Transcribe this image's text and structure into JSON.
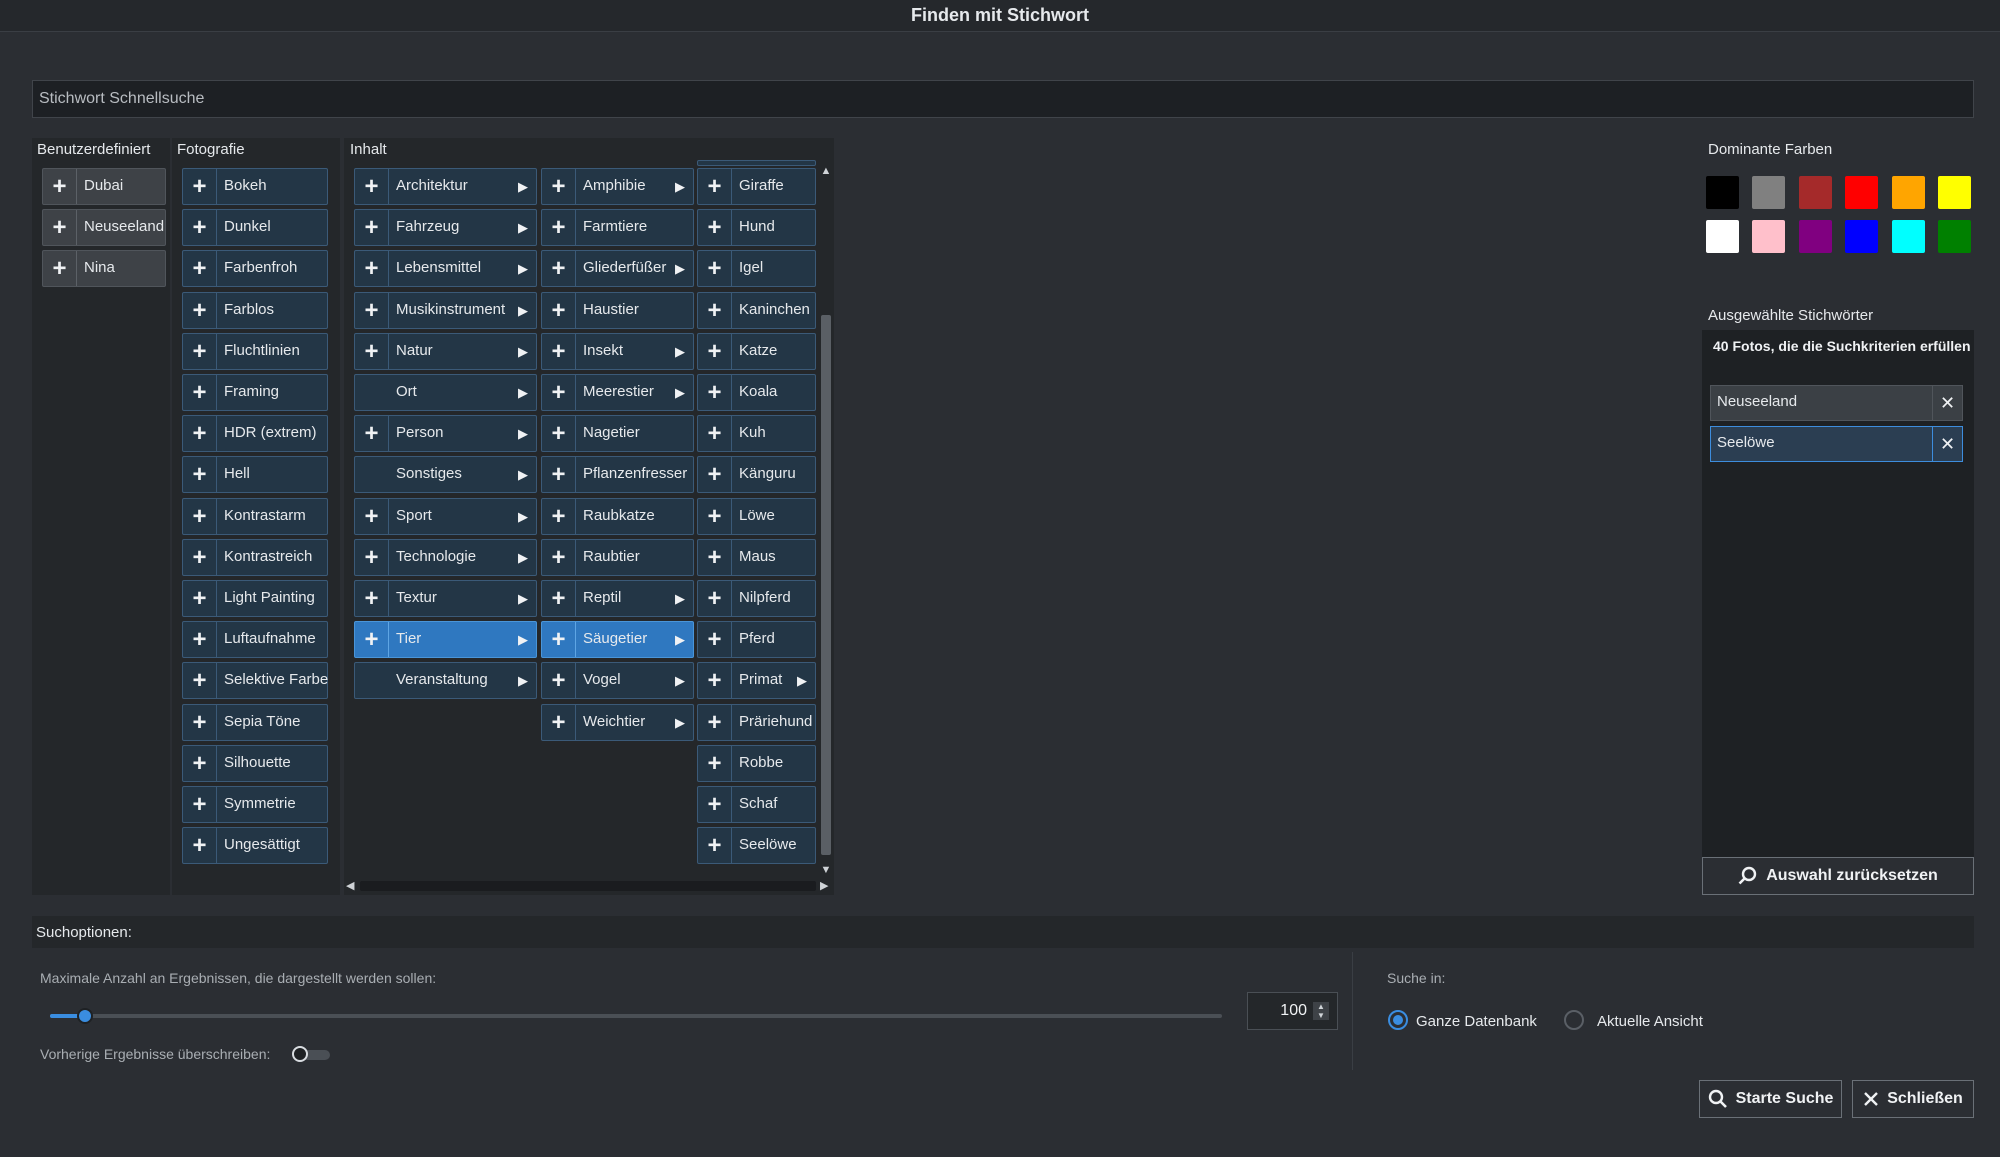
{
  "window": {
    "title": "Finden mit Stichwort"
  },
  "search": {
    "placeholder": "Stichwort Schnellsuche"
  },
  "columns": {
    "custom": {
      "title": "Benutzerdefiniert",
      "items": [
        "Dubai",
        "Neuseeland",
        "Nina"
      ]
    },
    "photography": {
      "title": "Fotografie",
      "items": [
        "Bokeh",
        "Dunkel",
        "Farbenfroh",
        "Farblos",
        "Fluchtlinien",
        "Framing",
        "HDR (extrem)",
        "Hell",
        "Kontrastarm",
        "Kontrastreich",
        "Light Painting",
        "Luftaufnahme",
        "Selektive Farbe",
        "Sepia Töne",
        "Silhouette",
        "Symmetrie",
        "Ungesättigt"
      ]
    },
    "content": {
      "title": "Inhalt",
      "col1": [
        {
          "label": "Architektur",
          "plus": true,
          "submenu": true
        },
        {
          "label": "Fahrzeug",
          "plus": true,
          "submenu": true
        },
        {
          "label": "Lebensmittel",
          "plus": true,
          "submenu": true
        },
        {
          "label": "Musikinstrument",
          "plus": true,
          "submenu": true
        },
        {
          "label": "Natur",
          "plus": true,
          "submenu": true
        },
        {
          "label": "Ort",
          "plus": false,
          "submenu": true
        },
        {
          "label": "Person",
          "plus": true,
          "submenu": true
        },
        {
          "label": "Sonstiges",
          "plus": false,
          "submenu": true
        },
        {
          "label": "Sport",
          "plus": true,
          "submenu": true
        },
        {
          "label": "Technologie",
          "plus": true,
          "submenu": true
        },
        {
          "label": "Textur",
          "plus": true,
          "submenu": true
        },
        {
          "label": "Tier",
          "plus": true,
          "submenu": true,
          "selected": true
        },
        {
          "label": "Veranstaltung",
          "plus": false,
          "submenu": true
        }
      ],
      "col2": [
        {
          "label": "Amphibie",
          "submenu": true
        },
        {
          "label": "Farmtiere",
          "submenu": false
        },
        {
          "label": "Gliederfüßer",
          "submenu": true
        },
        {
          "label": "Haustier",
          "submenu": false
        },
        {
          "label": "Insekt",
          "submenu": true
        },
        {
          "label": "Meerestier",
          "submenu": true
        },
        {
          "label": "Nagetier",
          "submenu": false
        },
        {
          "label": "Pflanzenfresser",
          "submenu": false
        },
        {
          "label": "Raubkatze",
          "submenu": false
        },
        {
          "label": "Raubtier",
          "submenu": false
        },
        {
          "label": "Reptil",
          "submenu": true
        },
        {
          "label": "Säugetier",
          "submenu": true,
          "selected": true
        },
        {
          "label": "Vogel",
          "submenu": true
        },
        {
          "label": "Weichtier",
          "submenu": true
        }
      ],
      "col3": [
        {
          "label": "Giraffe",
          "submenu": false
        },
        {
          "label": "Hund",
          "submenu": false
        },
        {
          "label": "Igel",
          "submenu": false
        },
        {
          "label": "Kaninchen",
          "submenu": false
        },
        {
          "label": "Katze",
          "submenu": false
        },
        {
          "label": "Koala",
          "submenu": false
        },
        {
          "label": "Kuh",
          "submenu": false
        },
        {
          "label": "Känguru",
          "submenu": false
        },
        {
          "label": "Löwe",
          "submenu": false
        },
        {
          "label": "Maus",
          "submenu": false
        },
        {
          "label": "Nilpferd",
          "submenu": false
        },
        {
          "label": "Pferd",
          "submenu": false
        },
        {
          "label": "Primat",
          "submenu": true
        },
        {
          "label": "Präriehund",
          "submenu": false
        },
        {
          "label": "Robbe",
          "submenu": false
        },
        {
          "label": "Schaf",
          "submenu": false
        },
        {
          "label": "Seelöwe",
          "submenu": false
        }
      ]
    }
  },
  "colors": {
    "title": "Dominante Farben",
    "swatches": [
      "#000000",
      "#808080",
      "#a52a2a",
      "#ff0000",
      "#ffa500",
      "#ffff00",
      "#ffffff",
      "#ffc0cb",
      "#800080",
      "#0000ff",
      "#00ffff",
      "#008000"
    ]
  },
  "selected": {
    "title": "Ausgewählte Stichwörter",
    "result_text": "40 Fotos, die die Suchkriterien erfüllen",
    "chips": [
      "Neuseeland",
      "Seelöwe"
    ],
    "reset_label": "Auswahl zurücksetzen"
  },
  "options": {
    "title": "Suchoptionen:",
    "max_results_label": "Maximale Anzahl an Ergebnissen, die dargestellt werden sollen:",
    "max_results_value": "100",
    "slider_fraction": 0.03,
    "overwrite_label": "Vorherige Ergebnisse überschreiben:",
    "overwrite_on": false,
    "search_in_label": "Suche in:",
    "search_in_options": [
      "Ganze Datenbank",
      "Aktuelle Ansicht"
    ],
    "search_in_selected": 0
  },
  "buttons": {
    "start": "Starte Suche",
    "close": "Schließen"
  }
}
